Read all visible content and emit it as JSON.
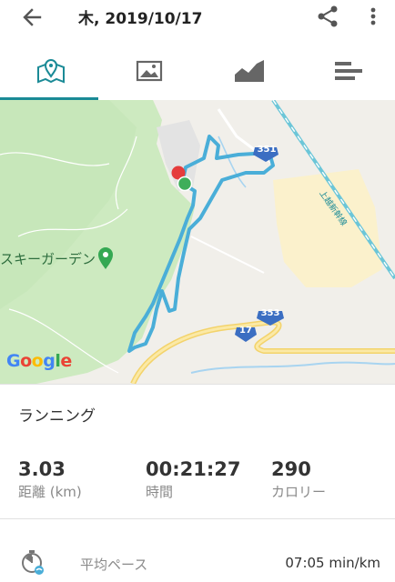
{
  "header": {
    "title": "木, 2019/10/17",
    "back_icon": "arrow-back-icon",
    "share_icon": "share-icon",
    "more_icon": "more-vert-icon"
  },
  "tabs": [
    {
      "name": "map-tab",
      "icon": "map-pin-icon",
      "active": true
    },
    {
      "name": "photo-tab",
      "icon": "image-icon",
      "active": false
    },
    {
      "name": "chart-tab",
      "icon": "area-chart-icon",
      "active": false
    },
    {
      "name": "splits-tab",
      "icon": "bars-icon",
      "active": false
    }
  ],
  "map": {
    "place_label": "スキーガーデン",
    "road_351": "351",
    "road_353": "353",
    "road_17": "17",
    "rail_label": "上越新幹線",
    "google_logo": "Google",
    "route_color": "#4aaed8"
  },
  "activity": {
    "type": "ランニング"
  },
  "stats": {
    "distance_value": "3.03",
    "distance_label": "距離 (km)",
    "time_value": "00:21:27",
    "time_label": "時間",
    "calories_value": "290",
    "calories_label": "カロリー"
  },
  "pace": {
    "label": "平均ペース",
    "value": "07:05 min/km"
  }
}
